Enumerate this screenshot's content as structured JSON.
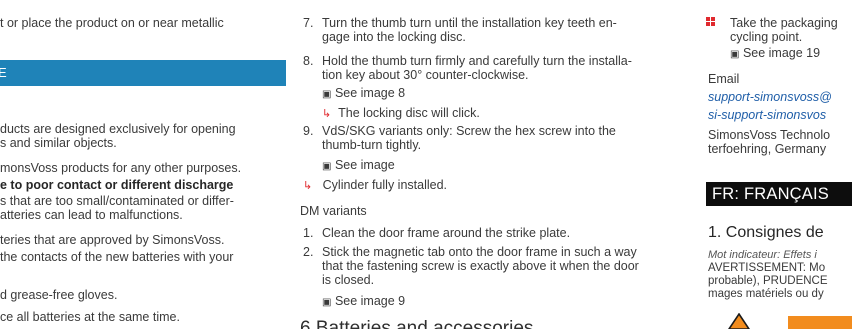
{
  "col1": {
    "top_line": "t or place the product on or near metallic",
    "bar_label": "E",
    "lines": [
      "ducts are designed exclusively for opening",
      "s and similar objects.",
      "monsVoss products for any other purposes.",
      "e to poor contact or different discharge",
      "s that are too small/contaminated or differ-",
      "atteries can lead to malfunctions.",
      "teries that are approved by SimonsVoss.",
      " the contacts of the new batteries with your",
      "d grease-free gloves.",
      "ce all batteries at the same time."
    ]
  },
  "col2": {
    "step7": {
      "num": "7.",
      "l1": "Turn the thumb turn until the installation key teeth en-",
      "l2": "gage into the locking disc."
    },
    "step8": {
      "num": "8.",
      "l1": "Hold the thumb turn firmly and carefully turn the installa-",
      "l2": "tion key about 30° counter-clockwise.",
      "see": "See image 8",
      "result": "The locking disc will click."
    },
    "step9": {
      "num": "9.",
      "l1": "VdS/SKG variants only: Screw the hex screw into the",
      "l2": "thumb-turn tightly.",
      "see": "See image"
    },
    "installed": "Cylinder fully installed.",
    "dm_heading": "DM variants",
    "dm1": {
      "num": "1.",
      "text": "Clean the door frame around the strike plate."
    },
    "dm2": {
      "num": "2.",
      "l1": "Stick the magnetic tab onto the door frame in such a way",
      "l2": "that the fastening screw is exactly above it when the door",
      "l3": "is closed.",
      "see": "See image 9"
    },
    "section6": "6  Batteries and accessories"
  },
  "col3": {
    "bullet_l1": "Take the packaging",
    "bullet_l2": "cycling point.",
    "bullet_see": "See image 19",
    "email_label": "Email",
    "email1": "support-simonsvoss@",
    "email2": "si-support-simonsvos",
    "company_l1": "SimonsVoss Technolo",
    "company_l2": "terfoehring, Germany",
    "fr_bar": "FR: FRANÇAIS",
    "fr_heading": "1. Consignes de",
    "fr_l1": "Mot indicateur: Effets i",
    "fr_l2": "AVERTISSEMENT: Mo",
    "fr_l3": "probable), PRUDENCE",
    "fr_l4": "mages matériels ou dy"
  },
  "glyphs": {
    "arrow": "↳",
    "square": "▣"
  },
  "colors": {
    "accent_blue": "#1f83b8",
    "red": "#e0292e",
    "orange": "#f28c1e"
  }
}
